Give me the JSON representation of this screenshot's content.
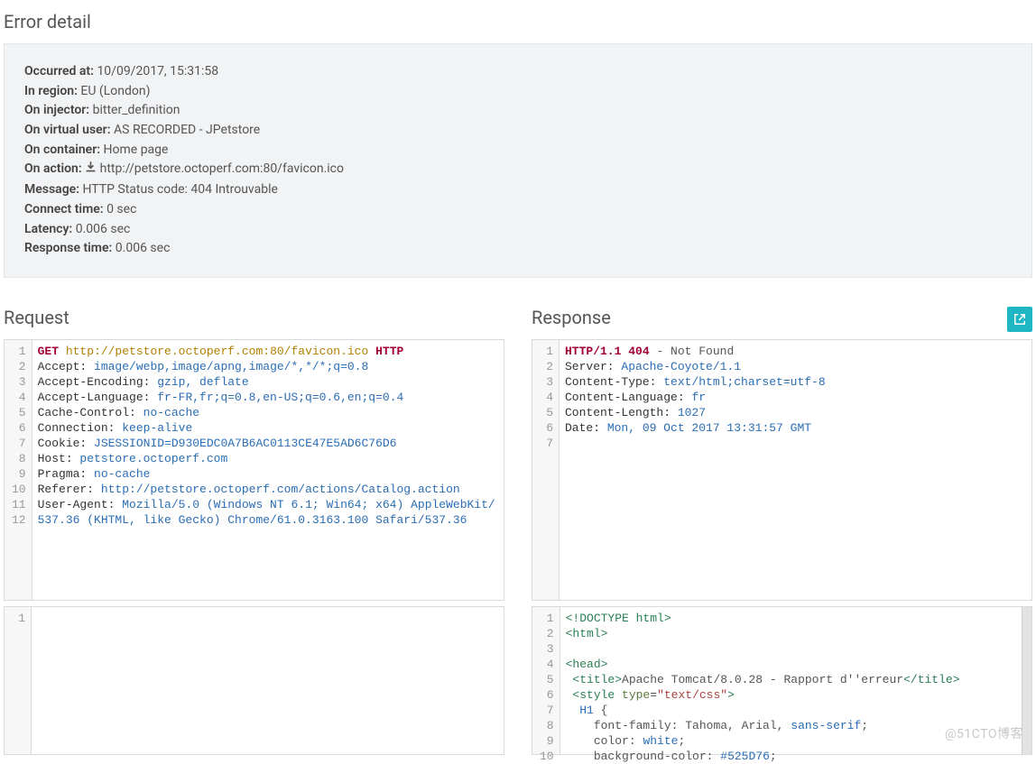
{
  "titles": {
    "error_detail": "Error detail",
    "request": "Request",
    "response": "Response"
  },
  "details": {
    "occurred_at_label": "Occurred at:",
    "occurred_at_value": "10/09/2017, 15:31:58",
    "in_region_label": "In region:",
    "in_region_value": "EU (London)",
    "on_injector_label": "On injector:",
    "on_injector_value": "bitter_definition",
    "on_virtual_user_label": "On virtual user:",
    "on_virtual_user_value": "AS RECORDED - JPetstore",
    "on_container_label": "On container:",
    "on_container_value": "Home page",
    "on_action_label": "On action:",
    "on_action_value": "http://petstore.octoperf.com:80/favicon.ico",
    "message_label": "Message:",
    "message_value": "HTTP Status code: 404 Introuvable",
    "connect_time_label": "Connect time:",
    "connect_time_value": "0 sec",
    "latency_label": "Latency:",
    "latency_value": "0.006 sec",
    "response_time_label": "Response time:",
    "response_time_value": "0.006 sec"
  },
  "request_lines": [
    {
      "n": 1,
      "tokens": [
        [
          "mtd",
          "GET"
        ],
        [
          "plain",
          " "
        ],
        [
          "url",
          "http://petstore.octoperf.com:80/favicon.ico"
        ],
        [
          "plain",
          " "
        ],
        [
          "proto",
          "HTTP"
        ]
      ]
    },
    {
      "n": 2,
      "tokens": [
        [
          "hk",
          "Accept: "
        ],
        [
          "hv",
          "image/webp,image/apng,image/*,*/*;q=0.8"
        ]
      ]
    },
    {
      "n": 3,
      "tokens": [
        [
          "hk",
          "Accept-Encoding: "
        ],
        [
          "hv",
          "gzip, deflate"
        ]
      ]
    },
    {
      "n": 4,
      "tokens": [
        [
          "hk",
          "Accept-Language: "
        ],
        [
          "hv",
          "fr-FR,fr;q=0.8,en-US;q=0.6,en;q=0.4"
        ]
      ]
    },
    {
      "n": 5,
      "tokens": [
        [
          "hk",
          "Cache-Control: "
        ],
        [
          "hv",
          "no-cache"
        ]
      ]
    },
    {
      "n": 6,
      "tokens": [
        [
          "hk",
          "Connection: "
        ],
        [
          "hv",
          "keep-alive"
        ]
      ]
    },
    {
      "n": 7,
      "tokens": [
        [
          "hk",
          "Cookie: "
        ],
        [
          "hv",
          "JSESSIONID=D930EDC0A7B6AC0113CE47E5AD6C76D6"
        ]
      ]
    },
    {
      "n": 8,
      "tokens": [
        [
          "hk",
          "Host: "
        ],
        [
          "hv",
          "petstore.octoperf.com"
        ]
      ]
    },
    {
      "n": 9,
      "tokens": [
        [
          "hk",
          "Pragma: "
        ],
        [
          "hv",
          "no-cache"
        ]
      ]
    },
    {
      "n": 10,
      "tokens": [
        [
          "hk",
          "Referer: "
        ],
        [
          "hv",
          "http://petstore.octoperf.com/actions/Catalog.action"
        ]
      ]
    },
    {
      "n": 11,
      "tokens": [
        [
          "hk",
          "User-Agent: "
        ],
        [
          "hv",
          "Mozilla/5.0 (Windows NT 6.1; Win64; x64) AppleWebKit/537.36 (KHTML, like Gecko) Chrome/61.0.3163.100 Safari/537.36"
        ]
      ]
    },
    {
      "n": 12,
      "tokens": [
        [
          "plain",
          ""
        ]
      ]
    }
  ],
  "request_body_lines": [
    {
      "n": 1,
      "tokens": [
        [
          "plain",
          ""
        ]
      ]
    }
  ],
  "response_header_lines": [
    {
      "n": 1,
      "tokens": [
        [
          "proto",
          "HTTP/1.1"
        ],
        [
          "plain",
          " "
        ],
        [
          "stat",
          "404"
        ],
        [
          "plain",
          " - Not Found"
        ]
      ]
    },
    {
      "n": 2,
      "tokens": [
        [
          "hk",
          "Server: "
        ],
        [
          "hv",
          "Apache-Coyote/1.1"
        ]
      ]
    },
    {
      "n": 3,
      "tokens": [
        [
          "hk",
          "Content-Type: "
        ],
        [
          "hv",
          "text/html;charset=utf-8"
        ]
      ]
    },
    {
      "n": 4,
      "tokens": [
        [
          "hk",
          "Content-Language: "
        ],
        [
          "hv",
          "fr"
        ]
      ]
    },
    {
      "n": 5,
      "tokens": [
        [
          "hk",
          "Content-Length: "
        ],
        [
          "num",
          "1027"
        ]
      ]
    },
    {
      "n": 6,
      "tokens": [
        [
          "hk",
          "Date: "
        ],
        [
          "hv",
          "Mon, 09 Oct 2017 13:31:57 GMT"
        ]
      ]
    },
    {
      "n": 7,
      "tokens": [
        [
          "plain",
          ""
        ]
      ]
    }
  ],
  "response_body_lines": [
    {
      "n": 1,
      "tokens": [
        [
          "tag",
          "<!DOCTYPE html>"
        ]
      ]
    },
    {
      "n": 2,
      "tokens": [
        [
          "tag",
          "<html>"
        ]
      ]
    },
    {
      "n": 3,
      "tokens": [
        [
          "plain",
          ""
        ]
      ]
    },
    {
      "n": 4,
      "tokens": [
        [
          "tag",
          "<head>"
        ]
      ]
    },
    {
      "n": 5,
      "tokens": [
        [
          "plain",
          " "
        ],
        [
          "tag",
          "<title>"
        ],
        [
          "plain",
          "Apache Tomcat/8.0.28 - Rapport d''erreur"
        ],
        [
          "tag",
          "</title>"
        ]
      ]
    },
    {
      "n": 6,
      "tokens": [
        [
          "plain",
          " "
        ],
        [
          "tag",
          "<style "
        ],
        [
          "attr",
          "type"
        ],
        [
          "plain",
          "="
        ],
        [
          "str",
          "\"text/css\""
        ],
        [
          "tag",
          ">"
        ]
      ]
    },
    {
      "n": 7,
      "tokens": [
        [
          "plain",
          "  "
        ],
        [
          "kw",
          "H1"
        ],
        [
          "plain",
          " {"
        ]
      ]
    },
    {
      "n": 8,
      "tokens": [
        [
          "plain",
          "    font-family: Tahoma, Arial, "
        ],
        [
          "kw",
          "sans-serif"
        ],
        [
          "plain",
          ";"
        ]
      ]
    },
    {
      "n": 9,
      "tokens": [
        [
          "plain",
          "    color: "
        ],
        [
          "kw",
          "white"
        ],
        [
          "plain",
          ";"
        ]
      ]
    },
    {
      "n": 10,
      "tokens": [
        [
          "plain",
          "    background-color: "
        ],
        [
          "hex",
          "#525D76"
        ],
        [
          "plain",
          ";"
        ]
      ]
    }
  ],
  "watermark": "@51CTO博客"
}
